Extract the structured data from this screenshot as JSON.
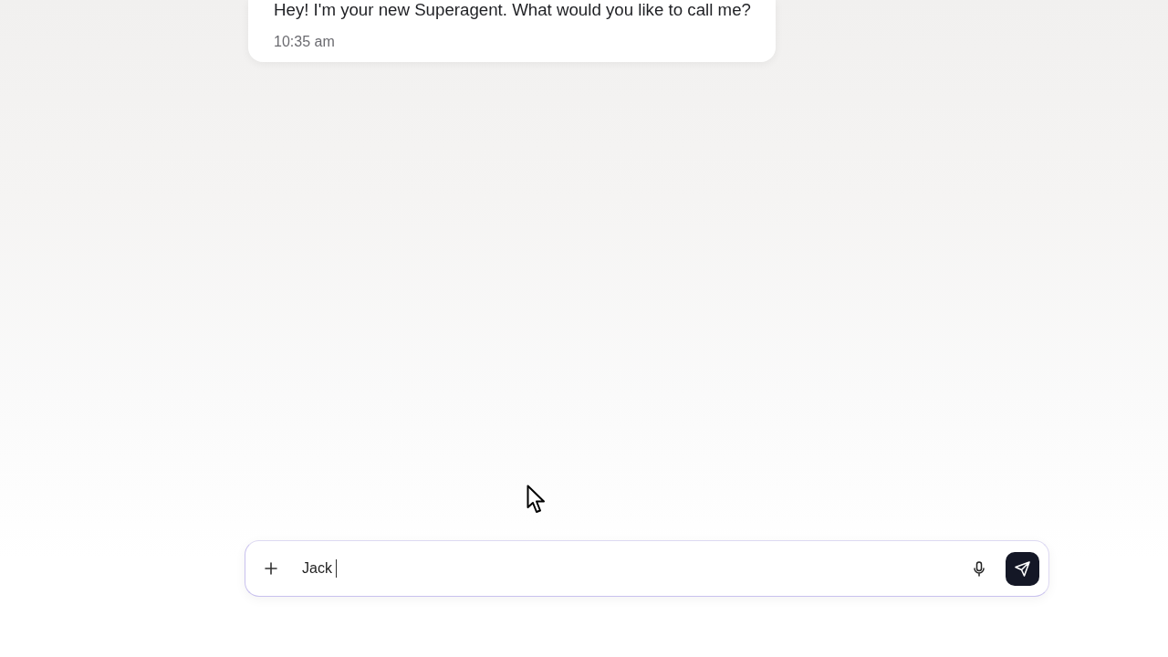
{
  "messages": [
    {
      "text": "Hey! I'm your new Superagent. What would you like to call me?",
      "time": "10:35 am"
    }
  ],
  "composer": {
    "value": "Jack",
    "focused": true
  }
}
